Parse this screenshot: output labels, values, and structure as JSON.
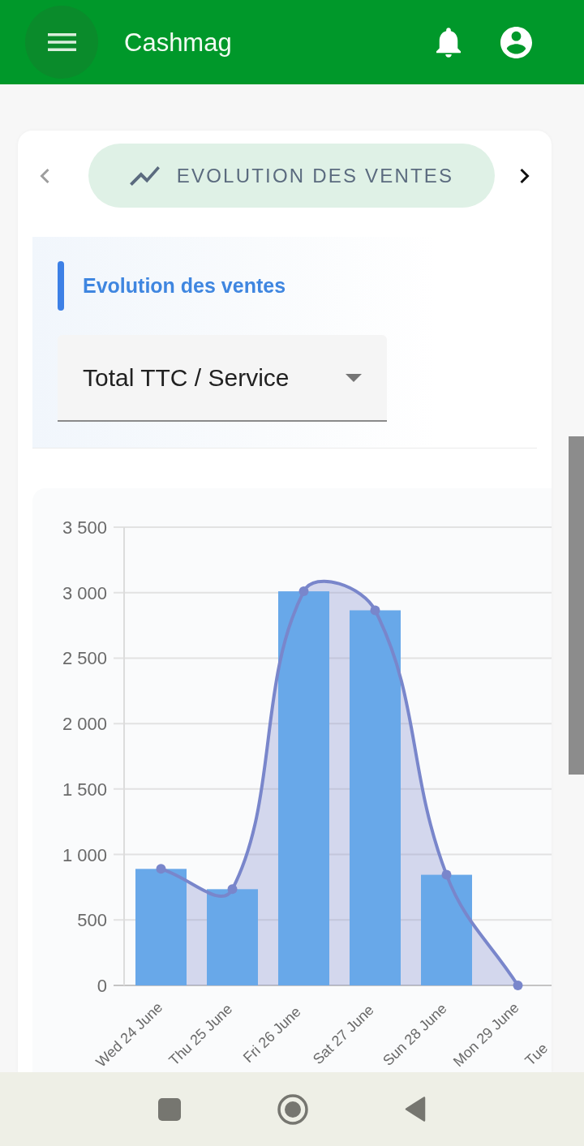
{
  "app_bar": {
    "title": "Cashmag"
  },
  "carousel": {
    "title": "EVOLUTION DES VENTES",
    "prev": {
      "disabled": true
    },
    "next": {
      "disabled": false
    }
  },
  "filter": {
    "title": "Evolution des ventes",
    "select": {
      "value": "Total TTC / Service"
    }
  },
  "chart": {
    "chart_data": {
      "type": "bar",
      "categories": [
        "Wed 24 June",
        "Thu 25 June",
        "Fri 26 June",
        "Sat 27 June",
        "Sun 28 June",
        "Mon 29 June",
        "Tue"
      ],
      "series": [
        {
          "color": "#68a8e9",
          "values": [
            890,
            735,
            3010,
            2865,
            845,
            0,
            null
          ]
        },
        {
          "type": "area",
          "color": "#7986cb",
          "values": [
            890,
            735,
            3010,
            2865,
            845,
            0,
            null
          ]
        }
      ],
      "ylim": [
        0,
        3500
      ],
      "grid": true,
      "yticks": [
        {
          "value": 0,
          "label": "0"
        },
        {
          "value": 500,
          "label": "500"
        },
        {
          "value": 1000,
          "label": "1 000"
        },
        {
          "value": 1500,
          "label": "1 500"
        },
        {
          "value": 2000,
          "label": "2 000"
        },
        {
          "value": 2500,
          "label": "2 500"
        },
        {
          "value": 3000,
          "label": "3 000"
        },
        {
          "value": 3500,
          "label": "3 500"
        }
      ]
    }
  }
}
